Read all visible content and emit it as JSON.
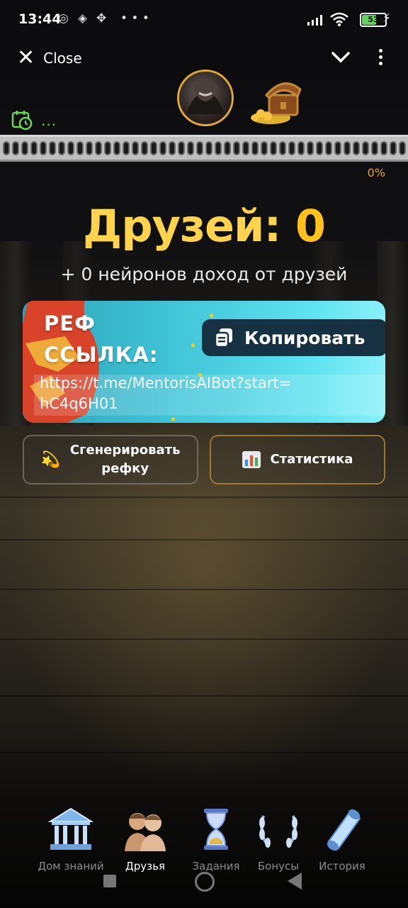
{
  "status_bar": {
    "time": "13:44",
    "battery": "53",
    "icons": [
      "vpn-icon",
      "binance-icon",
      "move-icon",
      "more-dots-icon",
      "signal-icon",
      "wifi-icon",
      "battery-icon",
      "charging-icon"
    ]
  },
  "header": {
    "close_label": "Close",
    "timer_dots": "...",
    "progress_percent": "0%",
    "progress_value": 0
  },
  "main": {
    "title_prefix": "Друзей:",
    "title_count": "0",
    "subtitle": "+ 0 нейронов доход от друзей",
    "ref_card": {
      "title_line1": "РЕФ",
      "title_line2": "ССЫЛКА:",
      "copy_label": "Копировать",
      "link": "https://t.me/MentorisAIBot?start=hC4q6H01"
    },
    "actions": {
      "generate_line1": "Сгенерировать",
      "generate_line2": "рефку",
      "stats_label": "Статистика"
    }
  },
  "bottom_nav": {
    "items": [
      {
        "label": "Дом знаний",
        "icon": "temple-icon"
      },
      {
        "label": "Друзья",
        "icon": "friends-busts-icon"
      },
      {
        "label": "Задания",
        "icon": "hourglass-icon"
      },
      {
        "label": "Бонусы",
        "icon": "laurel-wreath-icon"
      },
      {
        "label": "История",
        "icon": "scroll-icon"
      }
    ],
    "active": "Друзья"
  },
  "colors": {
    "accent_gold": "#e0a53b",
    "title_yellow": "#ffd34c",
    "timer_green": "#6bd65a",
    "ref_card_cyan": "#3fc3d6"
  }
}
